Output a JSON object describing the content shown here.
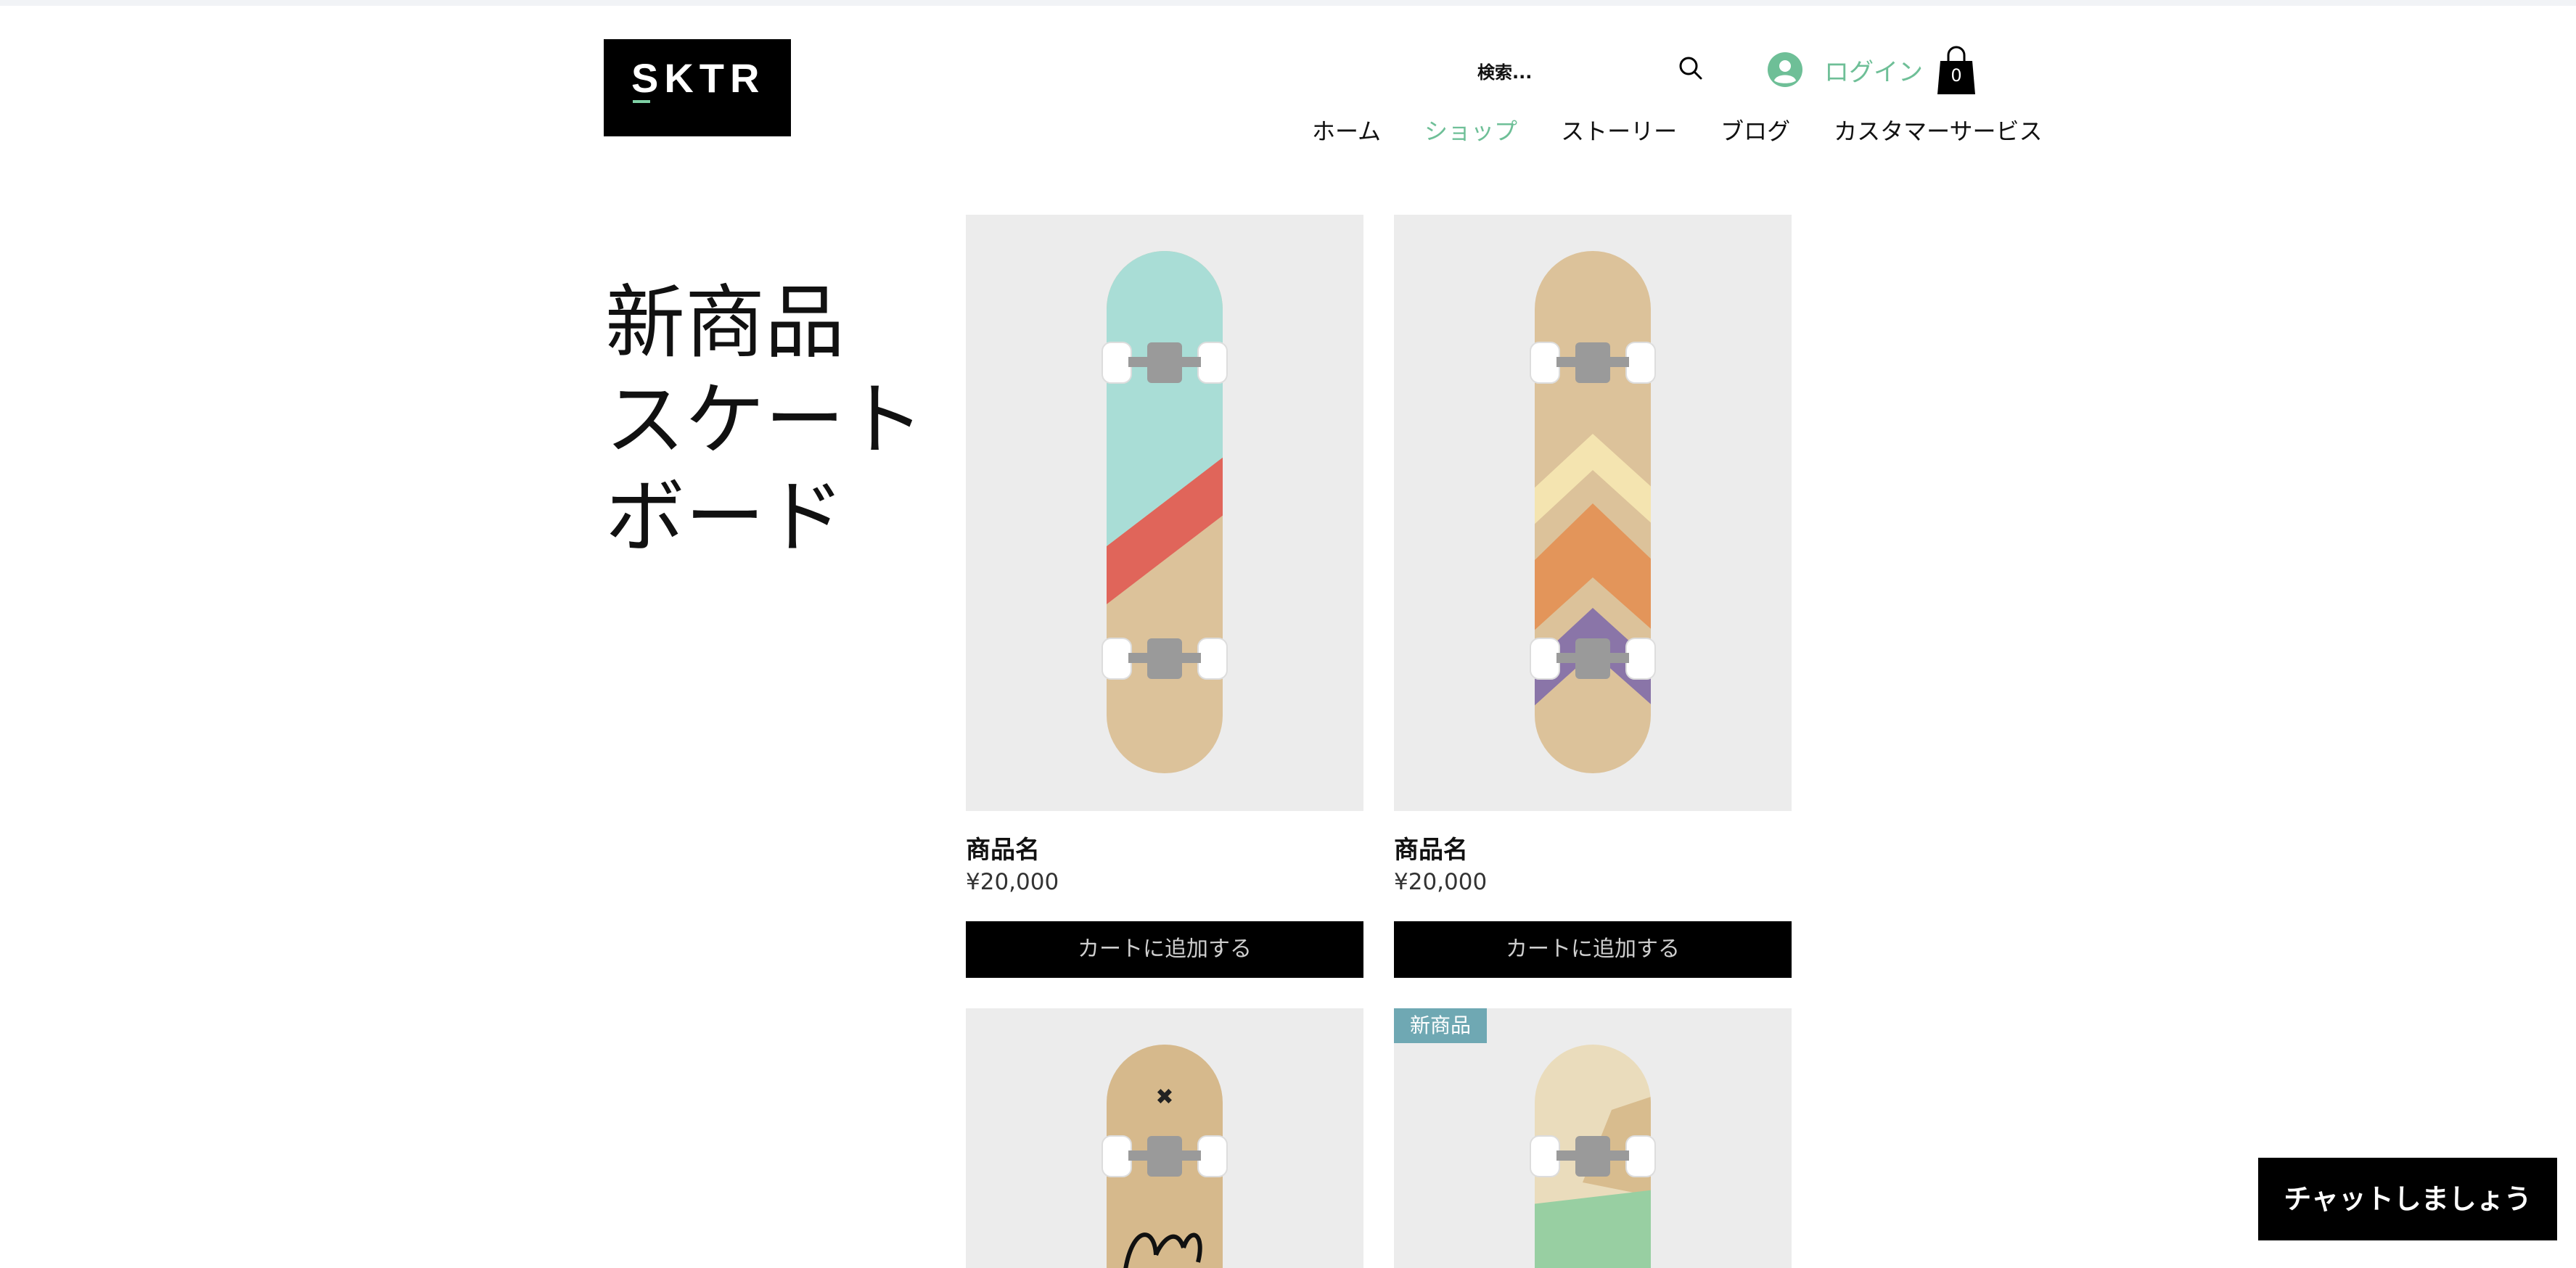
{
  "header": {
    "logo_text": "SKTR",
    "search": {
      "placeholder": "検索..."
    },
    "login_label": "ログイン",
    "cart_count": "0",
    "nav": [
      {
        "label": "ホーム",
        "active": false
      },
      {
        "label": "ショップ",
        "active": true
      },
      {
        "label": "ストーリー",
        "active": false
      },
      {
        "label": "ブログ",
        "active": false
      },
      {
        "label": "カスタマーサービス",
        "active": false
      }
    ]
  },
  "page": {
    "title_lines": [
      "新商品",
      "スケート",
      "ボード"
    ]
  },
  "products": [
    {
      "name": "商品名",
      "price": "¥20,000",
      "button": "カートに追加する"
    },
    {
      "name": "商品名",
      "price": "¥20,000",
      "button": "カートに追加する"
    },
    {
      "ribbon": ""
    },
    {
      "ribbon": "新商品"
    }
  ],
  "chat": {
    "label": "チャットしましょう"
  },
  "colors": {
    "accent": "#6ebf97",
    "ribbon": "#6fa8b3",
    "image_bg": "#ececec",
    "button_bg": "#000000"
  }
}
